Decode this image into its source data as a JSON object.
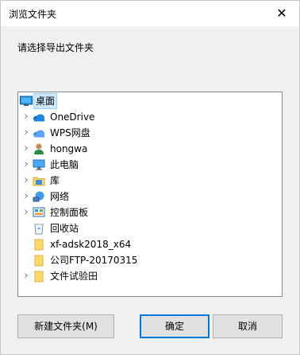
{
  "window": {
    "title": "浏览文件夹"
  },
  "dialog": {
    "instruction": "请选择导出文件夹"
  },
  "tree": {
    "items": [
      {
        "label": "桌面",
        "selected": true,
        "expandable": false,
        "icon": "desktop-icon"
      },
      {
        "label": "OneDrive",
        "selected": false,
        "expandable": true,
        "icon": "onedrive-cloud-icon"
      },
      {
        "label": "WPS网盘",
        "selected": false,
        "expandable": true,
        "icon": "wps-cloud-icon"
      },
      {
        "label": "hongwa",
        "selected": false,
        "expandable": true,
        "icon": "user-icon"
      },
      {
        "label": "此电脑",
        "selected": false,
        "expandable": true,
        "icon": "computer-icon"
      },
      {
        "label": "库",
        "selected": false,
        "expandable": true,
        "icon": "library-icon"
      },
      {
        "label": "网络",
        "selected": false,
        "expandable": true,
        "icon": "network-icon"
      },
      {
        "label": "控制面板",
        "selected": false,
        "expandable": true,
        "icon": "control-panel-icon"
      },
      {
        "label": "回收站",
        "selected": false,
        "expandable": false,
        "icon": "recycle-bin-icon"
      },
      {
        "label": "xf-adsk2018_x64",
        "selected": false,
        "expandable": false,
        "icon": "folder-icon"
      },
      {
        "label": "公司FTP-20170315",
        "selected": false,
        "expandable": false,
        "icon": "folder-icon"
      },
      {
        "label": "文件试验田",
        "selected": false,
        "expandable": true,
        "icon": "folder-icon"
      }
    ]
  },
  "buttons": {
    "new_folder": "新建文件夹(M)",
    "ok": "确定",
    "cancel": "取消"
  },
  "colors": {
    "selection": "#cce8ff",
    "accent": "#0078d7",
    "folder": "#ffd86b"
  }
}
